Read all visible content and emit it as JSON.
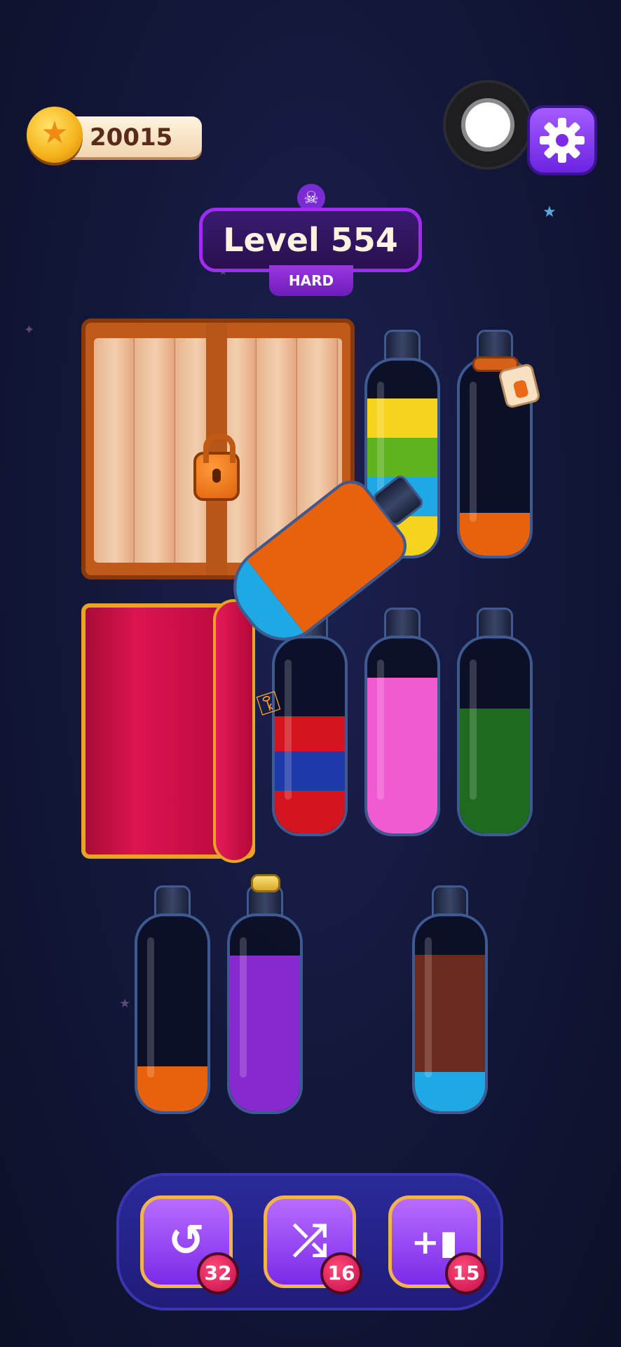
{
  "coins": {
    "value": "20015",
    "icon": "star-coin-icon"
  },
  "level": {
    "title": "Level 554",
    "difficulty": "HARD",
    "icon": "skull-icon"
  },
  "top_bar": {
    "record_icon": "record-icon",
    "settings_icon": "gear-icon"
  },
  "obstacles": {
    "crate_icon": "padlock-icon",
    "curtain": "curtain",
    "key_icon": "key-icon"
  },
  "colors": {
    "yellow": "#f4d41e",
    "green": "#5fb41e",
    "blue": "#1ea8e4",
    "orange": "#e8620e",
    "red": "#d4141e",
    "navy": "#1e3aa8",
    "pink": "#f05ad2",
    "darkgreen": "#1e6a1e",
    "purple": "#8a28d0",
    "brown": "#6a2a1e"
  },
  "bottles": [
    {
      "id": "b1",
      "segments": [
        {
          "color": "yellow",
          "frac": 0.2
        },
        {
          "color": "blue",
          "frac": 0.2
        },
        {
          "color": "green",
          "frac": 0.2
        },
        {
          "color": "yellow",
          "frac": 0.2
        }
      ],
      "extra": ""
    },
    {
      "id": "b2",
      "segments": [
        {
          "color": "orange",
          "frac": 0.22
        }
      ],
      "extra": "tag"
    },
    {
      "id": "b3",
      "segments": [
        {
          "color": "red",
          "frac": 0.22
        },
        {
          "color": "navy",
          "frac": 0.2
        },
        {
          "color": "red",
          "frac": 0.18
        }
      ],
      "extra": ""
    },
    {
      "id": "b4",
      "segments": [
        {
          "color": "pink",
          "frac": 0.8
        }
      ],
      "extra": ""
    },
    {
      "id": "b5",
      "segments": [
        {
          "color": "darkgreen",
          "frac": 0.64
        }
      ],
      "extra": ""
    },
    {
      "id": "b6",
      "segments": [
        {
          "color": "orange",
          "frac": 0.23
        }
      ],
      "extra": ""
    },
    {
      "id": "b7",
      "segments": [
        {
          "color": "purple",
          "frac": 0.8
        }
      ],
      "extra": "cork"
    },
    {
      "id": "b8",
      "segments": [
        {
          "color": "blue",
          "frac": 0.2
        },
        {
          "color": "brown",
          "frac": 0.6
        }
      ],
      "extra": ""
    }
  ],
  "pouring_bottle": {
    "segments": [
      {
        "color": "blue",
        "frac": 0.2
      },
      {
        "color": "orange",
        "frac": 0.8
      }
    ]
  },
  "tools": [
    {
      "name": "undo",
      "icon": "undo-icon",
      "count": "32"
    },
    {
      "name": "shuffle",
      "icon": "shuffle-icon",
      "count": "16"
    },
    {
      "name": "add-bottle",
      "icon": "add-bottle-icon",
      "count": "15"
    }
  ]
}
